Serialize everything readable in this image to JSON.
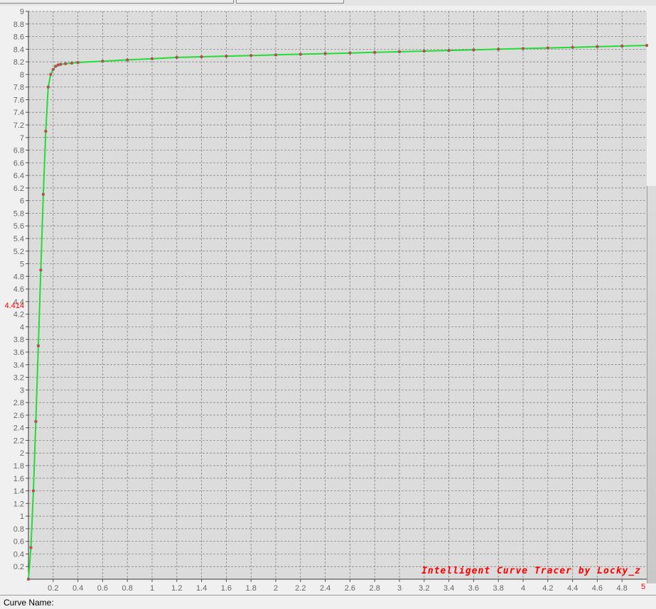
{
  "status_bar": {
    "curve_name_label": "Curve Name:"
  },
  "colors": {
    "curve": "#22dd33",
    "marker": "#cc4444",
    "plot_bg": "#dcdcdc",
    "grid": "#7a7a7a",
    "highlight": "#ff0000"
  },
  "chart_data": {
    "type": "line",
    "title": "",
    "xlabel": "",
    "ylabel": "",
    "xlim": [
      0,
      5
    ],
    "ylim": [
      0,
      9
    ],
    "x_ticks": [
      "0.2",
      "0.4",
      "0.6",
      "0.8",
      "1",
      "1.2",
      "1.4",
      "1.6",
      "1.8",
      "2",
      "2.2",
      "2.4",
      "2.6",
      "2.8",
      "3",
      "3.2",
      "3.4",
      "3.6",
      "3.8",
      "4",
      "4.2",
      "4.4",
      "4.6",
      "4.8"
    ],
    "y_ticks": [
      "0.2",
      "0.4",
      "0.6",
      "0.8",
      "1",
      "1.2",
      "1.4",
      "1.6",
      "1.8",
      "2",
      "2.2",
      "2.4",
      "2.6",
      "2.8",
      "3",
      "3.2",
      "3.4",
      "3.6",
      "3.8",
      "4",
      "4.2",
      "4.4",
      "4.6",
      "4.8",
      "5",
      "5.2",
      "5.4",
      "5.6",
      "5.8",
      "6",
      "6.2",
      "6.4",
      "6.6",
      "6.8",
      "7",
      "7.2",
      "7.4",
      "7.6",
      "7.8",
      "8",
      "8.2",
      "8.4",
      "8.6",
      "8.8",
      "9"
    ],
    "grid": true,
    "marker_y_label": "4.414",
    "marker_x_label": "5",
    "annotation": "Intelligent Curve Tracer by Locky_z",
    "series": [
      {
        "x": [
          0,
          0.02,
          0.04,
          0.06,
          0.08,
          0.1,
          0.12,
          0.14,
          0.16,
          0.18,
          0.2,
          0.22,
          0.24,
          0.26,
          0.3,
          0.35,
          0.4,
          0.6,
          0.8,
          1,
          1.2,
          1.4,
          1.6,
          1.8,
          2,
          2.2,
          2.4,
          2.6,
          2.8,
          3,
          3.2,
          3.4,
          3.6,
          3.8,
          4,
          4.2,
          4.4,
          4.6,
          4.8,
          5
        ],
        "y": [
          0,
          0.5,
          1.4,
          2.5,
          3.7,
          4.9,
          6.1,
          7.1,
          7.8,
          8.0,
          8.08,
          8.13,
          8.15,
          8.16,
          8.17,
          8.18,
          8.19,
          8.21,
          8.23,
          8.25,
          8.27,
          8.28,
          8.29,
          8.3,
          8.31,
          8.32,
          8.33,
          8.34,
          8.35,
          8.36,
          8.37,
          8.38,
          8.39,
          8.4,
          8.41,
          8.42,
          8.43,
          8.44,
          8.45,
          8.46
        ]
      }
    ]
  }
}
